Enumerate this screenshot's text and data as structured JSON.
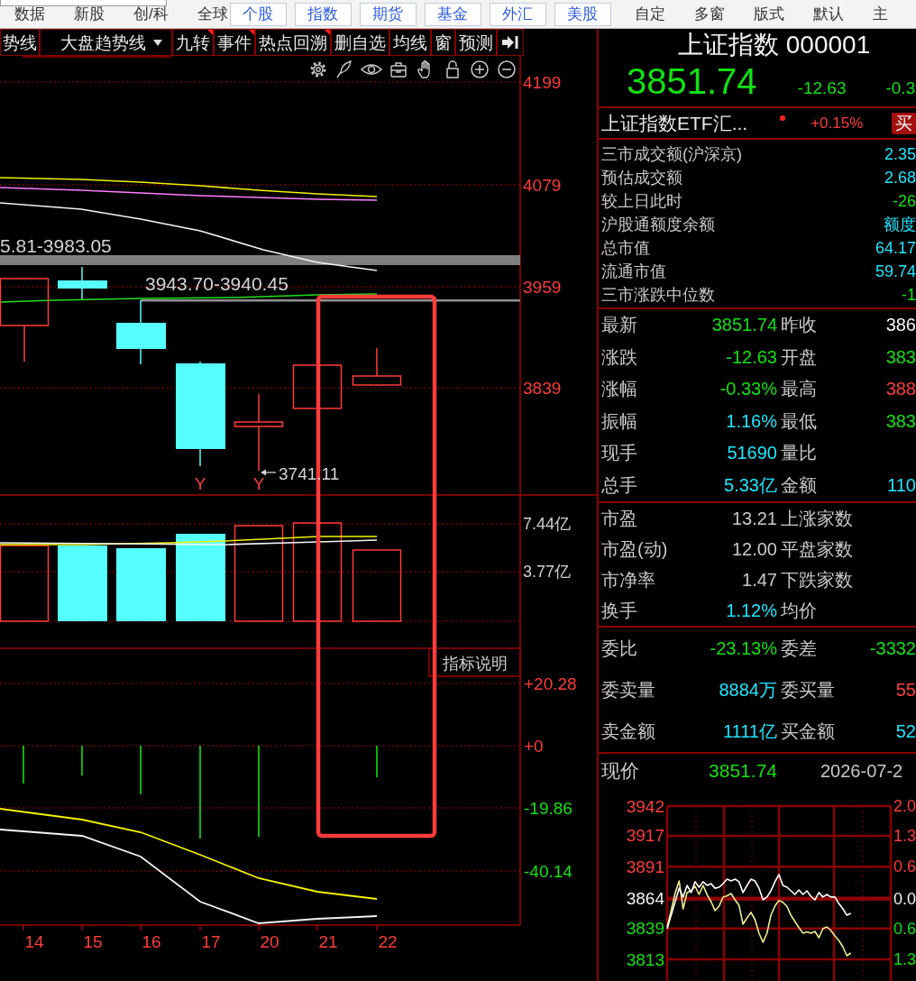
{
  "top_menu": [
    {
      "label": "数据",
      "kind": "plain"
    },
    {
      "label": "新股",
      "kind": "plain"
    },
    {
      "label": "创/科",
      "kind": "plain"
    },
    {
      "label": "全球",
      "kind": "plain"
    },
    {
      "label": "个股",
      "kind": "boxed"
    },
    {
      "label": "指数",
      "kind": "boxed"
    },
    {
      "label": "期货",
      "kind": "boxed"
    },
    {
      "label": "基金",
      "kind": "boxed"
    },
    {
      "label": "外汇",
      "kind": "boxed"
    },
    {
      "label": "美股",
      "kind": "boxed"
    },
    {
      "label": "自定",
      "kind": "plain"
    },
    {
      "label": "多窗",
      "kind": "plain"
    },
    {
      "label": "版式",
      "kind": "plain"
    },
    {
      "label": "默认",
      "kind": "plain"
    },
    {
      "label": "主",
      "kind": "plain"
    }
  ],
  "chart_toolbar": [
    {
      "label": "势线",
      "kind": "button",
      "flagged": false
    },
    {
      "label": "大盘趋势线",
      "kind": "dropdown",
      "flagged": false
    },
    {
      "label": "九转",
      "kind": "button",
      "flagged": true
    },
    {
      "label": "事件",
      "kind": "button",
      "flagged": true
    },
    {
      "label": "热点回溯",
      "kind": "button",
      "flagged": true
    },
    {
      "label": "删自选",
      "kind": "button",
      "flagged": false
    },
    {
      "label": "均线",
      "kind": "button",
      "flagged": false
    },
    {
      "label": "窗",
      "kind": "button",
      "flagged": false
    },
    {
      "label": "预测",
      "kind": "button",
      "flagged": false
    }
  ],
  "kline_chart": {
    "y_axis": [
      "4199",
      "4079",
      "3959",
      "3839"
    ],
    "range_labels": [
      "5.81-3983.05",
      "3943.70-3940.45"
    ],
    "low_label": "3741.11",
    "signals": [
      "Y",
      "Y"
    ]
  },
  "volume_chart": {
    "y_axis": [
      "7.44亿",
      "3.77亿"
    ]
  },
  "indicator_chart": {
    "help_button": "指标说明",
    "y_axis": [
      {
        "label": "+20.28",
        "color": "#ff3b3b"
      },
      {
        "label": "+0",
        "color": "#ff3b3b"
      },
      {
        "label": "-19.86",
        "color": "#12e012"
      },
      {
        "label": "-40.14",
        "color": "#12e012"
      }
    ]
  },
  "x_axis": [
    "14",
    "15",
    "16",
    "17",
    "20",
    "21",
    "22"
  ],
  "quote": {
    "title": "上证指数 000001",
    "price": "3851.74",
    "change": "-12.63",
    "change_percent": "-0.3"
  },
  "etf": {
    "name": "上证指数ETF汇...",
    "change": "+0.15%",
    "buy_button": "买"
  },
  "market_stats": [
    {
      "label": "三市成交额(沪深京)",
      "value": "2.35",
      "color": "#1ee6ff"
    },
    {
      "label": "预估成交额",
      "value": "2.68",
      "color": "#1ee6ff"
    },
    {
      "label": "较上日此时",
      "value": "-26",
      "color": "#12e012"
    },
    {
      "label": "沪股通额度余额",
      "value": "额度",
      "color": "#1ee6ff"
    },
    {
      "label": "总市值",
      "value": "64.17",
      "color": "#1ee6ff"
    },
    {
      "label": "流通市值",
      "value": "59.74",
      "color": "#1ee6ff"
    },
    {
      "label": "三市涨跌中位数",
      "value": "-1",
      "color": "#12e012"
    }
  ],
  "quote_table": [
    {
      "cells": [
        {
          "label": "最新",
          "value": "3851.74",
          "color": "#12e012"
        },
        {
          "label": "昨收",
          "value": "386",
          "color": "#f4f4f4"
        }
      ]
    },
    {
      "cells": [
        {
          "label": "涨跌",
          "value": "-12.63",
          "color": "#12e012"
        },
        {
          "label": "开盘",
          "value": "383",
          "color": "#12e012"
        }
      ]
    },
    {
      "cells": [
        {
          "label": "涨幅",
          "value": "-0.33%",
          "color": "#12e012"
        },
        {
          "label": "最高",
          "value": "388",
          "color": "#ff3b3b"
        }
      ]
    },
    {
      "cells": [
        {
          "label": "振幅",
          "value": "1.16%",
          "color": "#1ee6ff"
        },
        {
          "label": "最低",
          "value": "383",
          "color": "#12e012"
        }
      ]
    },
    {
      "cells": [
        {
          "label": "现手",
          "value": "51690",
          "color": "#1ee6ff"
        },
        {
          "label": "量比"
        }
      ]
    },
    {
      "cells": [
        {
          "label": "总手",
          "value": "5.33亿",
          "color": "#1ee6ff"
        },
        {
          "label": "金额",
          "value": "110",
          "color": "#1ee6ff"
        }
      ]
    }
  ],
  "valuation_table": [
    {
      "cells": [
        {
          "label": "市盈",
          "value": "13.21",
          "color": "#c8c8c8"
        },
        {
          "label": "上涨家数"
        }
      ]
    },
    {
      "cells": [
        {
          "label": "市盈(动)",
          "value": "12.00",
          "color": "#c8c8c8"
        },
        {
          "label": "平盘家数"
        }
      ]
    },
    {
      "cells": [
        {
          "label": "市净率",
          "value": "1.47",
          "color": "#c8c8c8"
        },
        {
          "label": "下跌家数"
        }
      ]
    },
    {
      "cells": [
        {
          "label": "换手",
          "value": "1.12%",
          "color": "#1ee6ff"
        },
        {
          "label": "均价"
        }
      ]
    }
  ],
  "order_table": [
    {
      "cells": [
        {
          "label": "委比",
          "value": "-23.13%",
          "color": "#12e012"
        },
        {
          "label": "委差",
          "value": "-3332",
          "color": "#12e012"
        }
      ]
    },
    {
      "cells": [
        {
          "label": "委卖量",
          "value": "8884万",
          "color": "#1ee6ff"
        },
        {
          "label": "委买量",
          "value": "55",
          "color": "#ff3b3b"
        }
      ]
    },
    {
      "cells": [
        {
          "label": "卖金额",
          "value": "1111亿",
          "color": "#1ee6ff"
        },
        {
          "label": "买金额",
          "value": "52",
          "color": "#1ee6ff"
        }
      ]
    }
  ],
  "intraday": {
    "label": "现价",
    "price": "3851.74",
    "date": "2026-07-2",
    "left_axis": [
      {
        "color": "#ff3b3b"
      },
      {
        "color": "#ff3b3b"
      },
      {
        "color": "#ff3b3b"
      },
      {
        "color": "#f4f4f4"
      },
      {
        "color": "#12e012"
      },
      {
        "color": "#12e012"
      }
    ],
    "right_axis": [
      {
        "label": "2.0",
        "color": "#ff3b3b"
      },
      {
        "label": "1.3",
        "color": "#ff3b3b"
      },
      {
        "label": "0.6",
        "color": "#ff3b3b"
      },
      {
        "label": "0.0",
        "color": "#f4f4f4"
      },
      {
        "label": "0.6",
        "color": "#12e012"
      },
      {
        "label": "1.3",
        "color": "#12e012"
      }
    ],
    "chart_data": {
      "type": "line",
      "categories": [
        null,
        null,
        null,
        null,
        null,
        null,
        null,
        null,
        null,
        null,
        null,
        null,
        null,
        null,
        null,
        null,
        null,
        null,
        null,
        null,
        null,
        null,
        null,
        null,
        null,
        null,
        null,
        null,
        null,
        null,
        null,
        null,
        null,
        null,
        null,
        null,
        null,
        null,
        null,
        null,
        null,
        null,
        null,
        null,
        null,
        null,
        null,
        null,
        null,
        null,
        null,
        null,
        null,
        null,
        null,
        null,
        null
      ],
      "series": [
        {
          "color": "#ffffff",
          "values": [
            3838.8,
            3850.2,
            3861.6,
            3872.9,
            3865.4,
            3875.2,
            3869.2,
            3878.3,
            3873.7,
            3878.3,
            3875.2,
            3876.7,
            3872.9,
            3873.7,
            3876.7,
            3880.5,
            3879.0,
            3880.5,
            3878.3,
            3869.2,
            3875.2,
            3880.5,
            3879.0,
            3872.9,
            3863.1,
            3865.4,
            3870.7,
            3878.3,
            3884.3,
            3875.2,
            3873.7,
            3870.7,
            3867.6,
            3871.4,
            3867.6,
            3870.7,
            3866.1,
            3863.1,
            3869.2,
            3865.4,
            3867.6,
            3865.4,
            3865.4,
            3860.0,
            3855.5,
            3850.2,
            3851.7,
            null,
            null,
            null,
            null,
            null,
            null,
            null,
            null,
            null,
            null
          ]
        },
        {
          "color": "#f0f08a",
          "values": [
            3840.3,
            3854.0,
            3869.0,
            3879.0,
            3855.5,
            3869.2,
            3870.7,
            3874.5,
            3867.6,
            3875.2,
            3867.3,
            3861.6,
            3854.0,
            3857.8,
            3865.4,
            3866.5,
            3868.4,
            3863.1,
            3858.6,
            3842.6,
            3847.9,
            3852.5,
            3846.4,
            3835.0,
            3827.4,
            3835.0,
            3850.2,
            3858.0,
            3862.6,
            3861.0,
            3857.6,
            3850.1,
            3844.9,
            3839.8,
            3835.1,
            3836.1,
            3835.0,
            3836.5,
            3831.2,
            3838.8,
            3840.3,
            3837.3,
            3832.7,
            3828.9,
            3823.6,
            3816.0,
            3818.3,
            null,
            null,
            null,
            null,
            null,
            null,
            null,
            null,
            null,
            null
          ]
        }
      ],
      "ylim": [
        3813,
        3942
      ],
      "yticks": [
        3942,
        3917,
        3891,
        3864,
        3839,
        3813
      ],
      "grid": true,
      "ref_lines": [
        {
          "axis": "y",
          "value": 3864
        }
      ]
    }
  }
}
